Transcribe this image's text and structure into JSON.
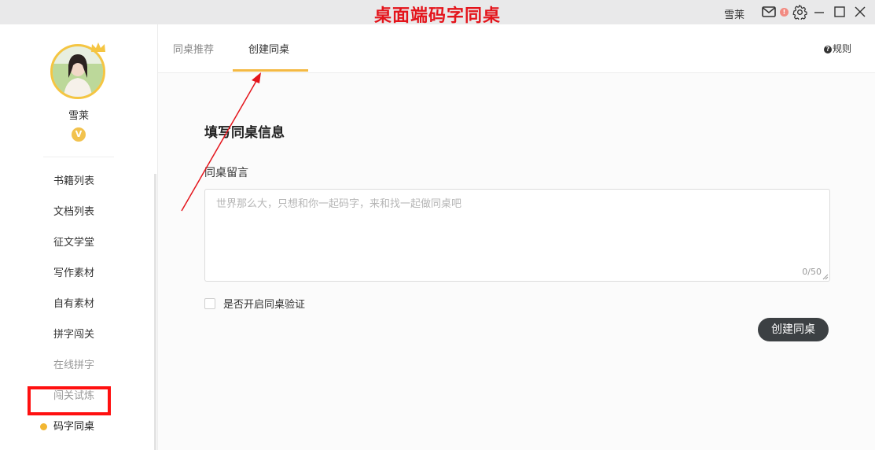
{
  "annotation": {
    "title": "桌面端码字同桌",
    "color": "#e4141b"
  },
  "titlebar": {
    "username": "雪莱",
    "mail_icon": "mail-icon",
    "badge": "!",
    "settings_icon": "gear-icon",
    "window_controls": [
      "minimize-icon",
      "maximize-icon",
      "close-icon"
    ]
  },
  "sidebar": {
    "username": "雪莱",
    "vip_badge": "V",
    "items": [
      {
        "label": "书籍列表",
        "state": "normal"
      },
      {
        "label": "文档列表",
        "state": "normal"
      },
      {
        "label": "征文学堂",
        "state": "normal"
      },
      {
        "label": "写作素材",
        "state": "normal"
      },
      {
        "label": "自有素材",
        "state": "normal"
      },
      {
        "label": "拼字闯关",
        "state": "normal"
      },
      {
        "label": "在线拼字",
        "state": "disabled"
      },
      {
        "label": "闯关试炼",
        "state": "disabled"
      },
      {
        "label": "码字同桌",
        "state": "active"
      }
    ],
    "accent": "#f2b632"
  },
  "main": {
    "tabs": [
      {
        "label": "同桌推荐",
        "active": false
      },
      {
        "label": "创建同桌",
        "active": true
      }
    ],
    "rules_label": "规则",
    "form": {
      "title": "填写同桌信息",
      "message_label": "同桌留言",
      "message_placeholder": "世界那么大，只想和你一起码字，来和找一起做同桌吧",
      "message_value": "",
      "char_count": "0/50",
      "verify_label": "是否开启同桌验证",
      "verify_checked": false,
      "submit_label": "创建同桌"
    }
  }
}
